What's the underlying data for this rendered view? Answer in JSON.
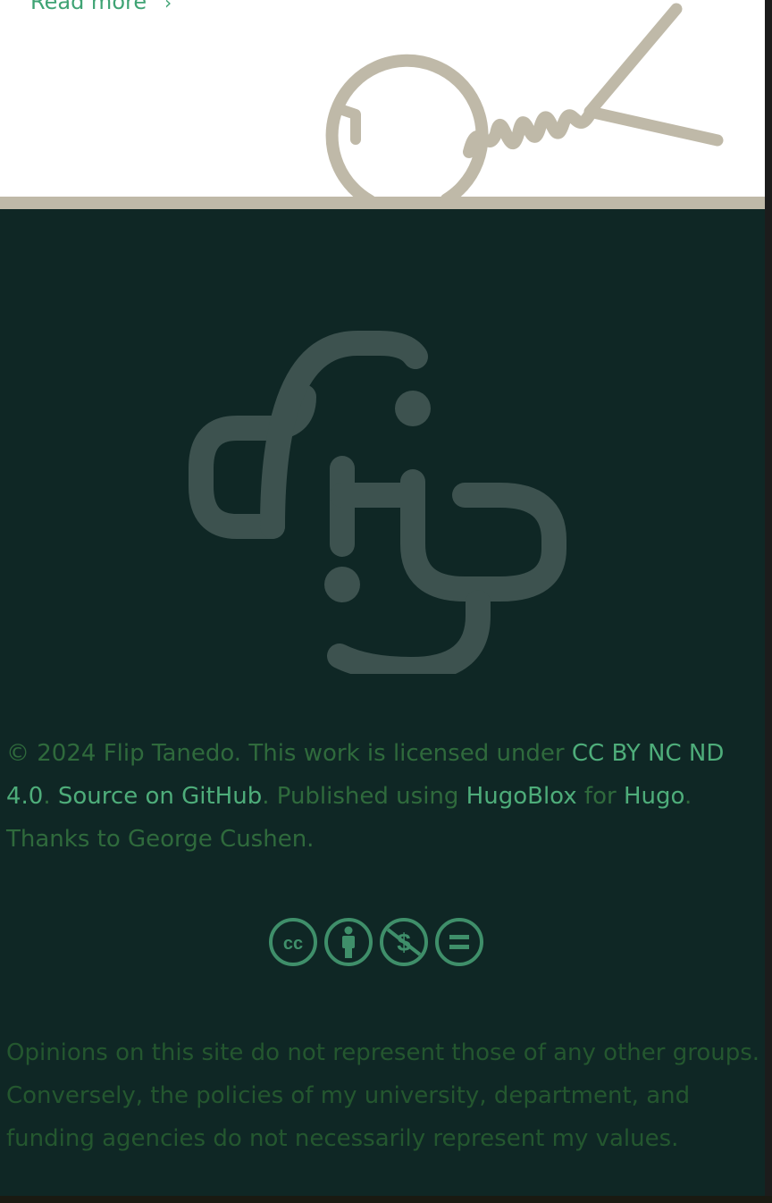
{
  "top": {
    "read_more_label": "Read more",
    "read_more_arrow": "›"
  },
  "colors": {
    "accent_green": "#4ead7a",
    "muted_green": "#2f6a3c",
    "footer_bg": "#0f2725",
    "divider_tan": "#bfb9a8",
    "logo_gray": "#3d524f"
  },
  "footer": {
    "copyright_prefix": "© 2024 Flip Tanedo. This work is licensed under ",
    "license_link": "CC BY NC ND 4.0",
    "sep1": ". ",
    "source_link": "Source on GitHub",
    "published_text": ". Published using ",
    "hugoblox_link": "HugoBlox",
    "for_text": " for ",
    "hugo_link": "Hugo",
    "thanks_text": ". Thanks to George Cushen.",
    "cc_icons": [
      "cc-icon",
      "by-icon",
      "nc-icon",
      "nd-icon"
    ],
    "disclaimer": "Opinions on this site do not represent those of any other groups. Conversely, the policies of my university, department, and funding agencies do not necessarily represent my values."
  }
}
